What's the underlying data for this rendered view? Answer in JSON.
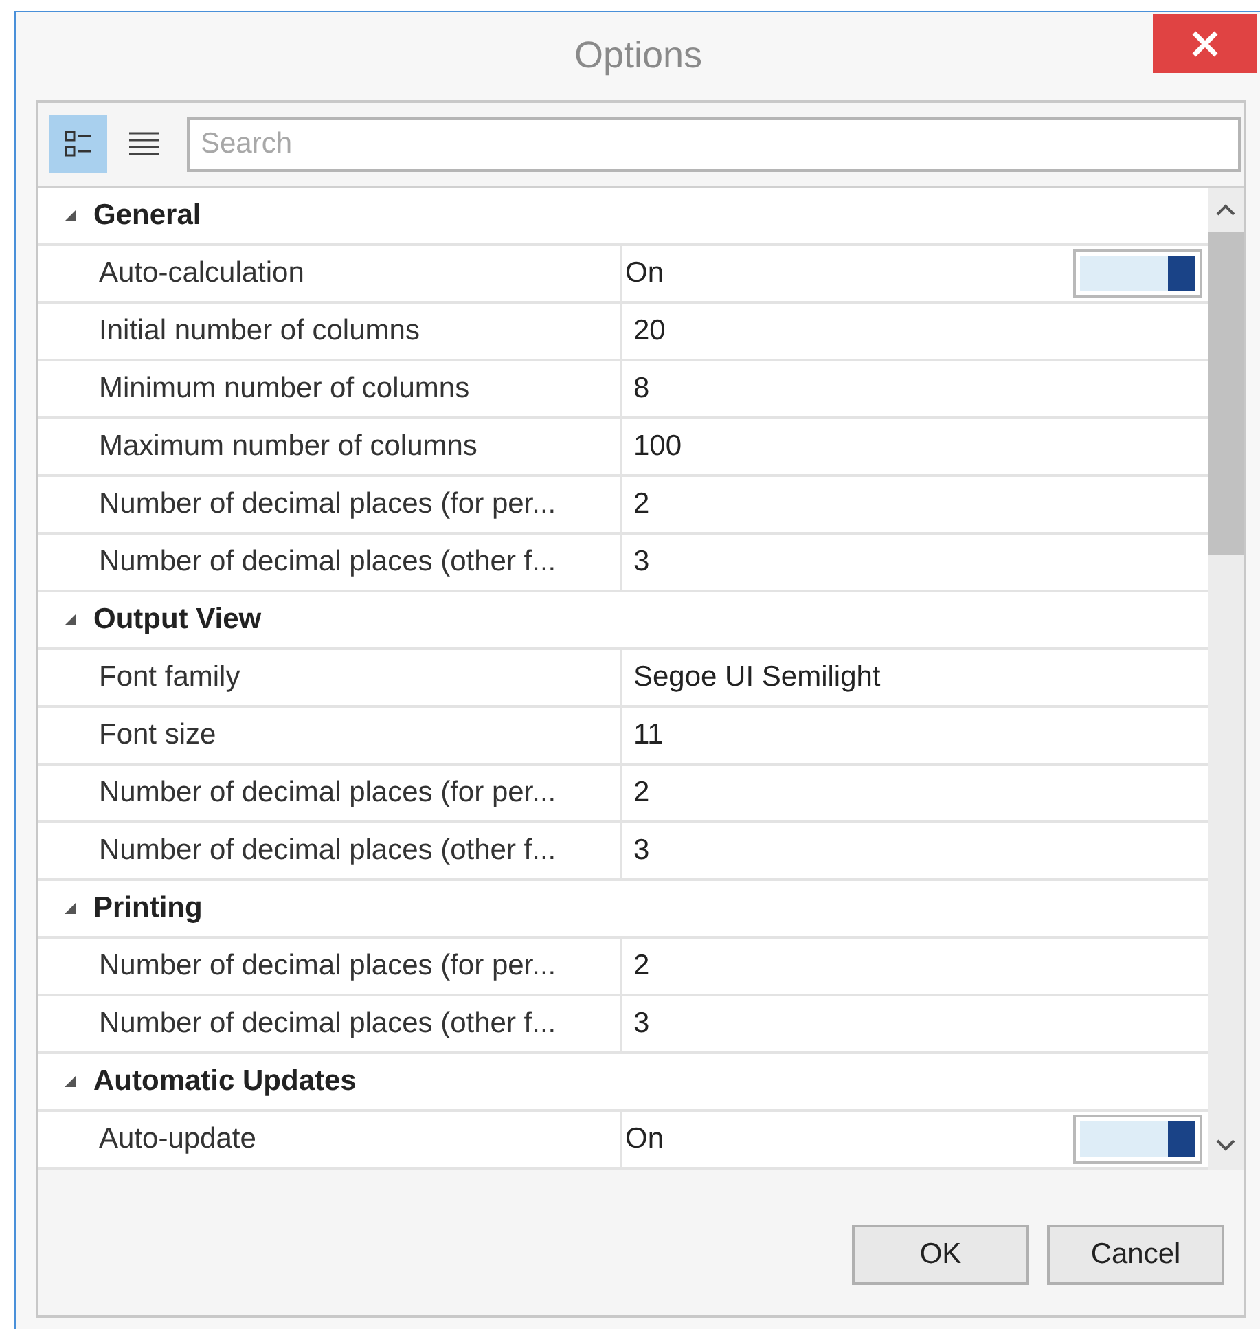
{
  "window": {
    "title": "Options"
  },
  "toolbar": {
    "view_modes": [
      {
        "kind": "categorized",
        "selected": true
      },
      {
        "kind": "alphabetical",
        "selected": false
      }
    ],
    "search": {
      "placeholder": "Search"
    }
  },
  "categories": [
    {
      "name": "General",
      "expanded": true,
      "properties": [
        {
          "name": "Auto-calculation",
          "value": "On",
          "kind": "toggle",
          "on": true
        },
        {
          "name": "Initial number of columns",
          "value": "20",
          "kind": "text"
        },
        {
          "name": "Minimum number of columns",
          "value": "8",
          "kind": "text"
        },
        {
          "name": "Maximum number of columns",
          "value": "100",
          "kind": "text"
        },
        {
          "name": "Number of decimal places (for per...",
          "value": "2",
          "kind": "text"
        },
        {
          "name": "Number of decimal places (other f...",
          "value": "3",
          "kind": "text"
        }
      ]
    },
    {
      "name": "Output View",
      "expanded": true,
      "properties": [
        {
          "name": "Font family",
          "value": "Segoe UI Semilight",
          "kind": "text"
        },
        {
          "name": "Font size",
          "value": "11",
          "kind": "text"
        },
        {
          "name": "Number of decimal places (for per...",
          "value": "2",
          "kind": "text"
        },
        {
          "name": "Number of decimal places (other f...",
          "value": "3",
          "kind": "text"
        }
      ]
    },
    {
      "name": "Printing",
      "expanded": true,
      "properties": [
        {
          "name": "Number of decimal places (for per...",
          "value": "2",
          "kind": "text"
        },
        {
          "name": "Number of decimal places (other f...",
          "value": "3",
          "kind": "text"
        }
      ]
    },
    {
      "name": "Automatic Updates",
      "expanded": true,
      "properties": [
        {
          "name": "Auto-update",
          "value": "On",
          "kind": "toggle",
          "on": true
        }
      ]
    }
  ],
  "buttons": [
    "OK",
    "Cancel"
  ]
}
